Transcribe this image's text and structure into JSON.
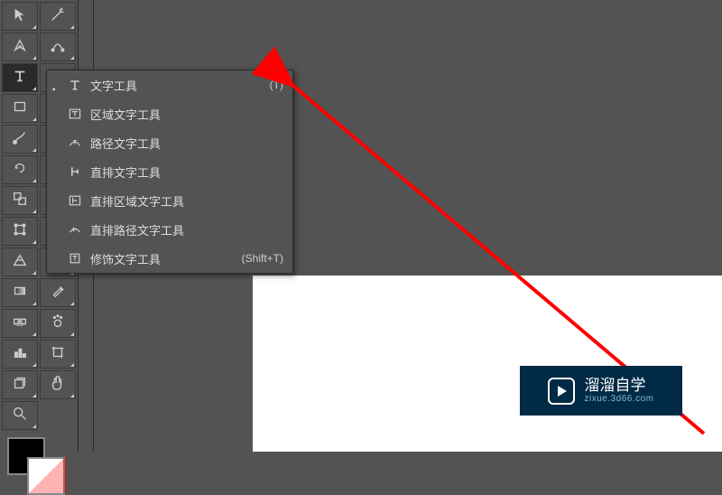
{
  "chart_data": null,
  "toolbar": {
    "tools": [
      {
        "name": "direct-selection-tool",
        "icon": "cursor"
      },
      {
        "name": "magic-wand-tool",
        "icon": "wand"
      },
      {
        "name": "pen-tool",
        "icon": "pen"
      },
      {
        "name": "curvature-pen-tool",
        "icon": "curvepen"
      },
      {
        "name": "type-tool",
        "icon": "type",
        "selected": true
      },
      {
        "name": "line-segment-tool",
        "icon": "line"
      },
      {
        "name": "rectangle-tool",
        "icon": "rect"
      },
      {
        "name": "ellipse-tool",
        "icon": "ellipse"
      },
      {
        "name": "paintbrush-tool",
        "icon": "brush"
      },
      {
        "name": "pencil-tool",
        "icon": "pencil"
      },
      {
        "name": "rotate-tool",
        "icon": "rotate"
      },
      {
        "name": "reflect-tool",
        "icon": "reflect"
      },
      {
        "name": "scale-tool",
        "icon": "scaletool"
      },
      {
        "name": "width-tool",
        "icon": "width"
      },
      {
        "name": "free-transform-tool",
        "icon": "free"
      },
      {
        "name": "shape-builder-tool",
        "icon": "shapebuilder"
      },
      {
        "name": "perspective-grid-tool",
        "icon": "perspective"
      },
      {
        "name": "mesh-tool",
        "icon": "mesh"
      },
      {
        "name": "gradient-tool",
        "icon": "gradient"
      },
      {
        "name": "eyedropper-tool",
        "icon": "eyedropper"
      },
      {
        "name": "blend-tool",
        "icon": "blend"
      },
      {
        "name": "symbol-sprayer-tool",
        "icon": "sprayer"
      },
      {
        "name": "column-graph-tool",
        "icon": "graph"
      },
      {
        "name": "artboard-tool",
        "icon": "artboard"
      },
      {
        "name": "slice-tool",
        "icon": "slice"
      },
      {
        "name": "hand-tool",
        "icon": "hand"
      },
      {
        "name": "zoom-tool",
        "icon": "zoom"
      }
    ]
  },
  "type_flyout": {
    "items": [
      {
        "label": "文字工具",
        "short": "(T)",
        "icon": "type",
        "selected": true
      },
      {
        "label": "区域文字工具",
        "short": "",
        "icon": "areatype"
      },
      {
        "label": "路径文字工具",
        "short": "",
        "icon": "pathtype"
      },
      {
        "label": "直排文字工具",
        "short": "",
        "icon": "vtype"
      },
      {
        "label": "直排区域文字工具",
        "short": "",
        "icon": "vareatype"
      },
      {
        "label": "直排路径文字工具",
        "short": "",
        "icon": "vpathtype"
      },
      {
        "label": "修饰文字工具",
        "short": "(Shift+T)",
        "icon": "touchtype"
      }
    ]
  },
  "watermark": {
    "title": "溜溜自学",
    "sub": "zixue.3d66.com"
  }
}
